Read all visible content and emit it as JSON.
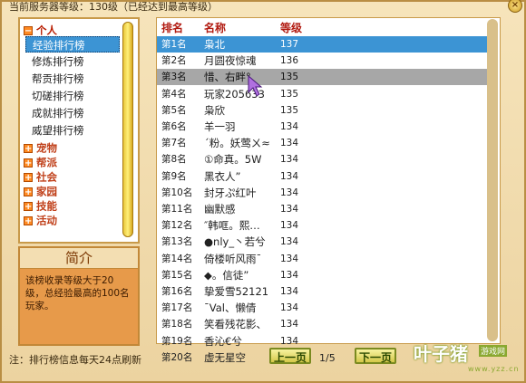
{
  "header": {
    "title": "当前服务器等级：130级（已经达到最高等级）",
    "close_label": "×"
  },
  "sidebar": {
    "categories": [
      {
        "label": "个人",
        "toggle": "−"
      },
      {
        "label": "宠物",
        "toggle": "+"
      },
      {
        "label": "帮派",
        "toggle": "+"
      },
      {
        "label": "社会",
        "toggle": "+"
      },
      {
        "label": "家园",
        "toggle": "+"
      },
      {
        "label": "技能",
        "toggle": "+"
      },
      {
        "label": "活动",
        "toggle": "+"
      }
    ],
    "sub_items": [
      "经验排行榜",
      "修炼排行榜",
      "帮贡排行榜",
      "切磋排行榜",
      "成就排行榜",
      "威望排行榜"
    ]
  },
  "intro": {
    "title": "简介",
    "text": "该榜收录等级大于20级，总经验最高的100名玩家。"
  },
  "table": {
    "headers": {
      "rank": "排名",
      "name": "名称",
      "level": "等级"
    },
    "rows": [
      {
        "rank": "第1名",
        "name": "枭北",
        "level": "137"
      },
      {
        "rank": "第2名",
        "name": "月圆夜惊魂",
        "level": "136"
      },
      {
        "rank": "第3名",
        "name": "惜、右畔°",
        "level": "135"
      },
      {
        "rank": "第4名",
        "name": "玩家205633",
        "level": "135"
      },
      {
        "rank": "第5名",
        "name": "枭欣",
        "level": "135"
      },
      {
        "rank": "第6名",
        "name": "羊一羽",
        "level": "134"
      },
      {
        "rank": "第7名",
        "name": "ˊ粉。妖莺ㄨ≈",
        "level": "134"
      },
      {
        "rank": "第8名",
        "name": "①命真。5W",
        "level": "134"
      },
      {
        "rank": "第9名",
        "name": "黑衣人”",
        "level": "134"
      },
      {
        "rank": "第10名",
        "name": "封牙ぷ红叶",
        "level": "134"
      },
      {
        "rank": "第11名",
        "name": "幽默感",
        "level": "134"
      },
      {
        "rank": "第12名",
        "name": "″韩哐。熙…",
        "level": "134"
      },
      {
        "rank": "第13名",
        "name": "●nly_丶若兮",
        "level": "134"
      },
      {
        "rank": "第14名",
        "name": "倚楼听风雨ˉ",
        "level": "134"
      },
      {
        "rank": "第15名",
        "name": "◆。信徒”",
        "level": "134"
      },
      {
        "rank": "第16名",
        "name": "挚爱雪52121",
        "level": "134"
      },
      {
        "rank": "第17名",
        "name": "ˉVal、懒倩",
        "level": "134"
      },
      {
        "rank": "第18名",
        "name": "笑看残花影、",
        "level": "134"
      },
      {
        "rank": "第19名",
        "name": "香沁€兮",
        "level": "134"
      },
      {
        "rank": "第20名",
        "name": "虚无星空",
        "level": "134"
      }
    ]
  },
  "footer": {
    "note": "注：排行榜信息每天24点刷新",
    "prev_label": "上一页",
    "next_label": "下一页",
    "page": "1/5"
  },
  "watermark": {
    "main": "叶子猪",
    "sub": "游戏网",
    "url": "www.yzz.cn"
  },
  "colors": {
    "selected_row": "#3c94d4",
    "hover_row": "#a7a7a7",
    "header_text": "#b11a10",
    "category_text": "#c0401a",
    "panel_border": "#c89a4a"
  }
}
